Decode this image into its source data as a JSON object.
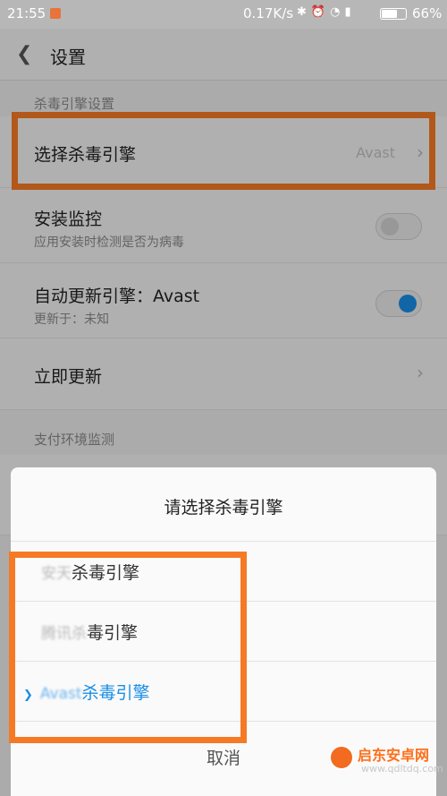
{
  "status_bar": {
    "time": "21:55",
    "net_speed": "0.17K/s",
    "icons": [
      "bluetooth-icon",
      "alarm-icon",
      "wifi-icon",
      "signal-icon"
    ],
    "battery_level": 0.66,
    "battery_text": "66%"
  },
  "header": {
    "title": "设置"
  },
  "antivirus_section": {
    "heading": "杀毒引擎设置",
    "select_engine": {
      "label": "选择杀毒引擎",
      "value": "Avast"
    },
    "install_monitor": {
      "label": "安装监控",
      "desc": "应用安装时检测是否为病毒",
      "enabled": false
    },
    "auto_update": {
      "label": "自动更新引擎：Avast",
      "desc": "更新于：未知",
      "enabled": true
    },
    "update_now": {
      "label": "立即更新"
    }
  },
  "payment_section": {
    "heading": "支付环境监测"
  },
  "dialog": {
    "title": "请选择杀毒引擎",
    "options": [
      {
        "brand": "安天",
        "suffix": "杀毒引擎",
        "selected": false
      },
      {
        "brand": "腾讯杀",
        "suffix": "毒引擎",
        "selected": false
      },
      {
        "brand": "Avast",
        "suffix": "杀毒引擎",
        "selected": true
      }
    ],
    "cancel": "取消"
  },
  "watermark": {
    "name": "启东安卓网",
    "url": "www.qdltdq.com"
  },
  "colors": {
    "accent": "#1a8ee6",
    "highlight": "#f57a25"
  }
}
